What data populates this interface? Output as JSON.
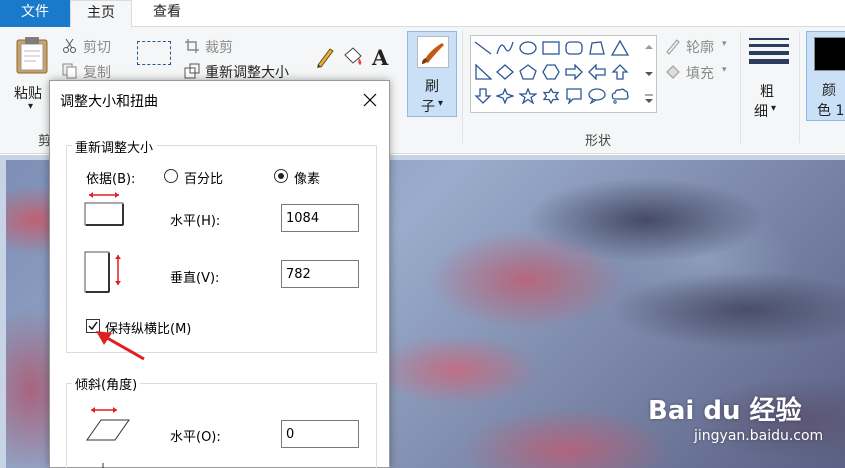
{
  "menu_tabs": {
    "file": "文件",
    "home": "主页",
    "view": "查看"
  },
  "ribbon": {
    "paste": {
      "label": "粘贴",
      "caret": "▾"
    },
    "cut": "剪切",
    "copy": "复制",
    "clipboard_group_partial": "剪",
    "crop": "裁剪",
    "resize": "重新调整大小",
    "brushes": {
      "line1": "刷",
      "line2": "子",
      "caret": "▾"
    },
    "outline": "轮廓",
    "fill": "填充",
    "shapes_group": "形状",
    "size": {
      "line1": "粗",
      "line2": "细",
      "caret": "▾"
    },
    "color1": {
      "line1": "颜",
      "line2": "色 1"
    }
  },
  "dialog": {
    "title": "调整大小和扭曲",
    "resize_group": "重新调整大小",
    "by_label": "依据(B):",
    "option_percent": "百分比",
    "option_pixels": "像素",
    "horizontal_label": "水平(H):",
    "horizontal_value": "1084",
    "vertical_label": "垂直(V):",
    "vertical_value": "782",
    "keep_aspect_label": "保持纵横比(M)",
    "keep_aspect_checked": true,
    "skew_group": "倾斜(角度)",
    "skew_horizontal_label": "水平(O):",
    "skew_horizontal_value": "0"
  },
  "watermark": {
    "logo": "Bai du 经验",
    "url": "jingyan.baidu.com"
  },
  "colors": {
    "accent": "#1979ca",
    "ribbon_bg": "#f5f6f7",
    "selected_btn": "#c9e0f7",
    "arrow": "#e02020"
  }
}
